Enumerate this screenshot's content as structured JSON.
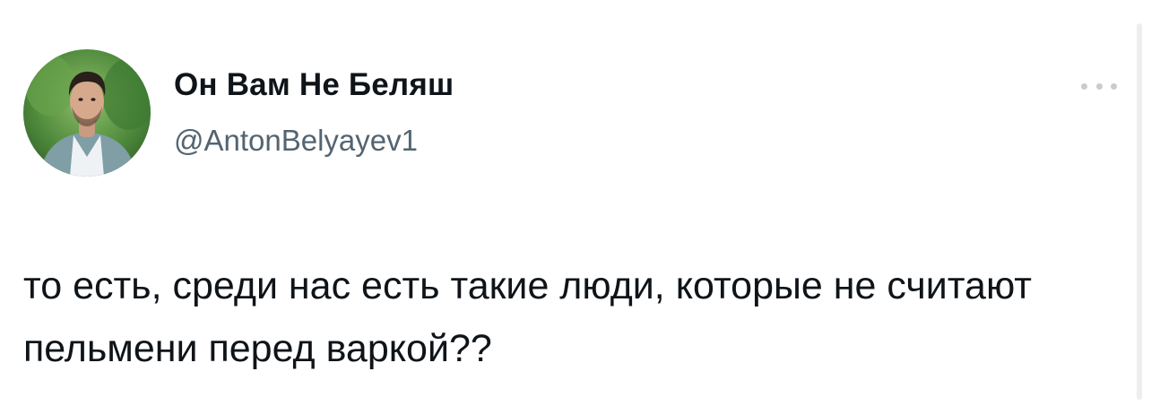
{
  "author": {
    "display_name": "Он Вам Не Беляш",
    "handle": "@AntonBelyayev1",
    "avatar": "profile-photo"
  },
  "tweet": {
    "text": "то есть, среди нас есть такие люди, которые не считают пельмени перед варкой??"
  },
  "icons": {
    "more": "more-horizontal-icon"
  },
  "colors": {
    "text_primary": "#0f1419",
    "text_secondary": "#536471",
    "icon_muted": "#c8ccd0"
  }
}
